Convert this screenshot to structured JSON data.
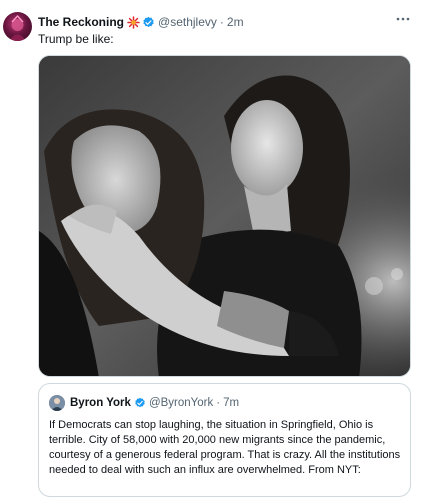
{
  "post": {
    "author_name": "The Reckoning",
    "author_handle": "@sethjlevy",
    "separator": "·",
    "timestamp": "2m",
    "text": "Trump be like:",
    "more_icon": "ellipsis-icon",
    "badge_icon": "sparkle-emoji-icon",
    "verified_icon": "verified-badge-icon",
    "verified_color": "#1d9bf0"
  },
  "quoted_post": {
    "author_name": "Byron York",
    "author_handle": "@ByronYork",
    "separator": "·",
    "timestamp": "7m",
    "text": "If Democrats can stop laughing, the situation in Springfield, Ohio is terrible. City of 58,000 with 20,000 new migrants since the pandemic, courtesy of a generous federal program. That is crazy. All the institutions needed to deal with such an influx are overwhelmed. From NYT:"
  }
}
